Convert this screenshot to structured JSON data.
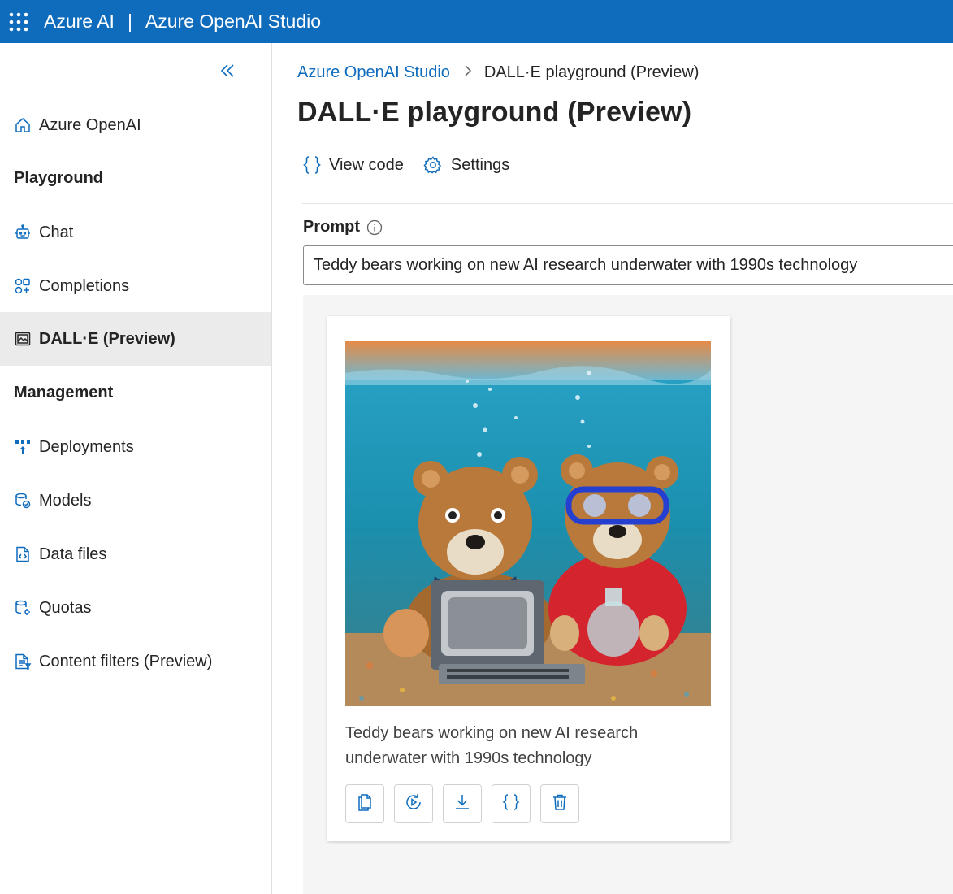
{
  "topbar": {
    "brand": "Azure AI",
    "separator": "|",
    "studio": "Azure OpenAI Studio"
  },
  "sidebar": {
    "items": [
      {
        "label": "Azure OpenAI",
        "icon": "home-icon"
      },
      {
        "label": "Chat",
        "icon": "bot-icon"
      },
      {
        "label": "Completions",
        "icon": "completions-icon"
      },
      {
        "label": "DALL·E (Preview)",
        "icon": "image-icon",
        "active": true
      },
      {
        "label": "Deployments",
        "icon": "deployments-icon"
      },
      {
        "label": "Models",
        "icon": "models-icon"
      },
      {
        "label": "Data files",
        "icon": "data-files-icon"
      },
      {
        "label": "Quotas",
        "icon": "quotas-icon"
      },
      {
        "label": "Content filters (Preview)",
        "icon": "content-filters-icon"
      }
    ],
    "headings": {
      "playground": "Playground",
      "management": "Management"
    }
  },
  "breadcrumb": {
    "root": "Azure OpenAI Studio",
    "current": "DALL·E playground (Preview)"
  },
  "page": {
    "title": "DALL·E playground (Preview)"
  },
  "toolbar": {
    "view_code": "View code",
    "settings": "Settings"
  },
  "prompt": {
    "label": "Prompt",
    "value": "Teddy bears working on new AI research underwater with 1990s technology"
  },
  "result": {
    "caption": "Teddy bears working on new AI research underwater with 1990s technology",
    "actions": [
      "copy-icon",
      "variations-icon",
      "download-icon",
      "code-icon",
      "delete-icon"
    ]
  },
  "colors": {
    "accent": "#0f6cbd",
    "active_bg": "#ebebeb"
  }
}
